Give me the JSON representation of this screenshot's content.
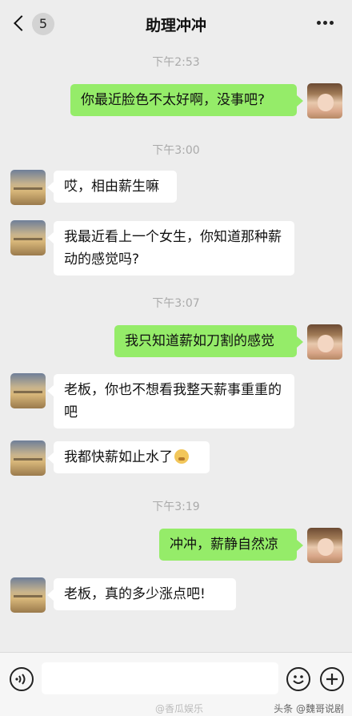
{
  "header": {
    "back_count": "5",
    "title": "助理冲冲"
  },
  "messages": [
    {
      "id": "ts1",
      "type": "timestamp",
      "text": "下午2:53"
    },
    {
      "id": "m1",
      "type": "out",
      "text": "你最近脸色不太好啊，没事吧?"
    },
    {
      "id": "ts2",
      "type": "timestamp",
      "text": "下午3:00"
    },
    {
      "id": "m2",
      "type": "in",
      "text": "哎，相由薪生嘛"
    },
    {
      "id": "m3",
      "type": "in",
      "text": "我最近看上一个女生，你知道那种薪动的感觉吗?"
    },
    {
      "id": "ts3",
      "type": "timestamp",
      "text": "下午3:07"
    },
    {
      "id": "m4",
      "type": "out",
      "text": "我只知道薪如刀割的感觉"
    },
    {
      "id": "m5",
      "type": "in",
      "text": "老板，你也不想看我整天薪事重重的吧"
    },
    {
      "id": "m6",
      "type": "in",
      "text": "我都快薪如止水了",
      "emoji": "flushed-emoji"
    },
    {
      "id": "ts4",
      "type": "timestamp",
      "text": "下午3:19"
    },
    {
      "id": "m7",
      "type": "out",
      "text": "冲冲，薪静自然凉"
    },
    {
      "id": "m8",
      "type": "in",
      "text": "老板，真的多少涨点吧!"
    }
  ],
  "input_bar": {
    "voice_icon": "voice-icon",
    "emoji_icon": "emoji-icon",
    "add_icon": "plus-icon"
  },
  "watermarks": {
    "left": "@香瓜娱乐",
    "right": "头条 @魏哥说剧"
  }
}
